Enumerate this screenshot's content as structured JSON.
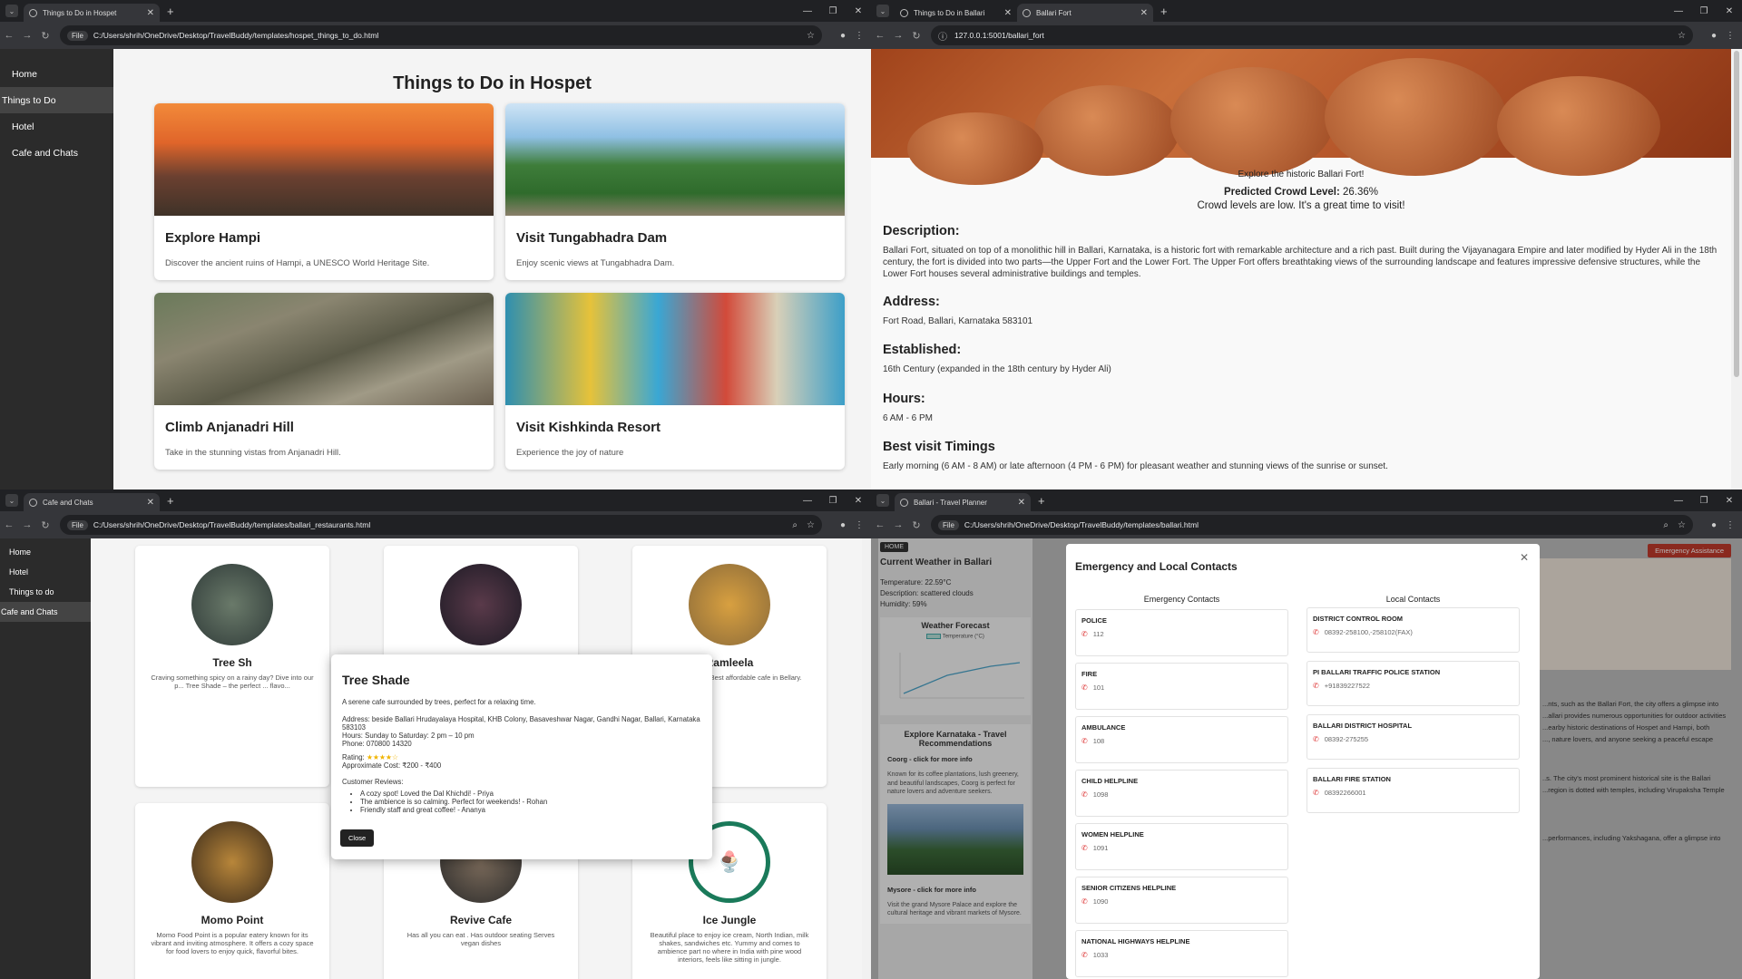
{
  "w1": {
    "tab_title": "Things to Do in Hospet",
    "url_chip": "File",
    "url": "C:/Users/shrih/OneDrive/Desktop/TravelBuddy/templates/hospet_things_to_do.html",
    "sidebar": [
      "Home",
      "Things to Do",
      "Hotel",
      "Cafe and Chats"
    ],
    "heading": "Things to Do in Hospet",
    "cards": [
      {
        "title": "Explore Hampi",
        "desc": "Discover the ancient ruins of Hampi, a UNESCO World Heritage Site."
      },
      {
        "title": "Visit Tungabhadra Dam",
        "desc": "Enjoy scenic views at Tungabhadra Dam."
      },
      {
        "title": "Climb Anjanadri Hill",
        "desc": "Take in the stunning vistas from Anjanadri Hill."
      },
      {
        "title": "Visit Kishkinda Resort",
        "desc": "Experience the joy of nature"
      }
    ]
  },
  "w2": {
    "tabs": [
      "Things to Do in Ballari",
      "Ballari Fort"
    ],
    "url": "127.0.0.1:5001/ballari_fort",
    "explore": "Explore the historic Ballari Fort!",
    "crowd_label": "Predicted Crowd Level:",
    "crowd_value": "26.36%",
    "crowd_msg": "Crowd levels are low. It's a great time to visit!",
    "sections": [
      {
        "h": "Description:",
        "t": "Ballari Fort, situated on top of a monolithic hill in Ballari, Karnataka, is a historic fort with remarkable architecture and a rich past. Built during the Vijayanagara Empire and later modified by Hyder Ali in the 18th century, the fort is divided into two parts—the Upper Fort and the Lower Fort. The Upper Fort offers breathtaking views of the surrounding landscape and features impressive defensive structures, while the Lower Fort houses several administrative buildings and temples."
      },
      {
        "h": "Address:",
        "t": "Fort Road, Ballari, Karnataka 583101"
      },
      {
        "h": "Established:",
        "t": "16th Century (expanded in the 18th century by Hyder Ali)"
      },
      {
        "h": "Hours:",
        "t": "6 AM - 6 PM"
      },
      {
        "h": "Best visit Timings",
        "t": "Early morning (6 AM - 8 AM) or late afternoon (4 PM - 6 PM) for pleasant weather and stunning views of the sunrise or sunset."
      }
    ]
  },
  "w3": {
    "tab_title": "Cafe and Chats",
    "url_chip": "File",
    "url": "C:/Users/shrih/OneDrive/Desktop/TravelBuddy/templates/ballari_restaurants.html",
    "sidebar": [
      "Home",
      "Hotel",
      "Things to do",
      "Cafe and Chats"
    ],
    "cards": [
      {
        "name": "Tree Sh",
        "desc": "Craving something spicy on a rainy day? Dive into our p... Tree Shade – the perfect ... flavo..."
      },
      {
        "name": "",
        "desc": ""
      },
      {
        "name": "Ramleela",
        "desc": "Presenting you a Best affordable cafe in Bellary."
      },
      {
        "name": "Momo Point",
        "desc": "Momo Food Point is a popular eatery known for its vibrant and inviting atmosphere. It offers a cozy space for food lovers to enjoy quick, flavorful bites."
      },
      {
        "name": "Revive Cafe",
        "desc": "Has all you can eat . Has outdoor seating Serves vegan dishes"
      },
      {
        "name": "Ice Jungle",
        "desc": "Beautiful place to enjoy ice cream, North Indian, milk shakes, sandwiches etc. Yummy and comes to ambience part no where in India with pine wood interiors, feels like sitting in jungle."
      }
    ],
    "modal": {
      "title": "Tree Shade",
      "desc": "A serene cafe surrounded by trees, perfect for a relaxing time.",
      "address": "Address: beside Ballari Hrudayalaya Hospital, KHB Colony, Basaveshwar Nagar, Gandhi Nagar, Ballari, Karnataka 583103",
      "hours": "Hours: Sunday to Saturday: 2 pm – 10 pm",
      "phone": "Phone: 070800 14320",
      "rating_label": "Rating:",
      "rating": 4.5,
      "rating_stars": "★★★★☆",
      "cost": "Approximate Cost: ₹200 - ₹400",
      "reviews_label": "Customer Reviews:",
      "reviews": [
        "A cozy spot! Loved the Dal Khichdi! - Priya",
        "The ambience is so calming. Perfect for weekends! - Rohan",
        "Friendly staff and great coffee! - Ananya"
      ],
      "close": "Close"
    }
  },
  "w4": {
    "tab_title": "Ballari - Travel Planner",
    "url_chip": "File",
    "url": "C:/Users/shrih/OneDrive/Desktop/TravelBuddy/templates/ballari.html",
    "home_btn": "HOME",
    "weather_title": "Current Weather in Ballari",
    "temperature": "Temperature: 22.59°C",
    "description": "Description: scattered clouds",
    "humidity": "Humidity: 59%",
    "forecast_title": "Weather Forecast",
    "legend": "Temperature (°C)",
    "rec_title": "Explore Karnataka - Travel Recommendations",
    "coorg_title": "Coorg - click for more info",
    "coorg_desc": "Known for its coffee plantations, lush greenery, and beautiful landscapes, Coorg is perfect for nature lovers and adventure seekers.",
    "mysore_title": "Mysore - click for more info",
    "mysore_desc": "Visit the grand Mysore Palace and explore the cultural heritage and vibrant markets of Mysore.",
    "emergency_btn": "Emergency Assistance",
    "bg_text": [
      "...nts, such as the Ballari Fort, the city offers a glimpse into",
      "...allari provides numerous opportunities for outdoor activities",
      "...earby historic destinations of Hospet and Hampi, both",
      "..., nature lovers, and anyone seeking a peaceful escape",
      "..s. The city's most prominent historical site is the Ballari",
      "...region is dotted with temples, including Virupaksha Temple",
      "...performances, including Yakshagana, offer a glimpse into"
    ],
    "modal_title": "Emergency and Local Contacts",
    "emergency_heading": "Emergency Contacts",
    "local_heading": "Local Contacts",
    "emergency": [
      {
        "name": "POLICE",
        "num": "112"
      },
      {
        "name": "FIRE",
        "num": "101"
      },
      {
        "name": "AMBULANCE",
        "num": "108"
      },
      {
        "name": "CHILD HELPLINE",
        "num": "1098"
      },
      {
        "name": "WOMEN HELPLINE",
        "num": "1091"
      },
      {
        "name": "SENIOR CITIZENS HELPLINE",
        "num": "1090"
      },
      {
        "name": "NATIONAL HIGHWAYS HELPLINE",
        "num": "1033"
      }
    ],
    "local": [
      {
        "name": "DISTRICT CONTROL ROOM",
        "num": "08392-258100,-258102(FAX)"
      },
      {
        "name": "PI BALLARI TRAFFIC POLICE STATION",
        "num": "+91839227522"
      },
      {
        "name": "BALLARI DISTRICT HOSPITAL",
        "num": "08392-275255"
      },
      {
        "name": "BALLARI FIRE STATION",
        "num": "08392266001"
      }
    ]
  }
}
